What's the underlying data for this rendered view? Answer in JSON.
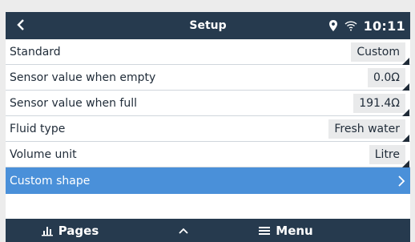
{
  "header": {
    "title": "Setup",
    "time": "10:11"
  },
  "settings": [
    {
      "label": "Standard",
      "value": "Custom"
    },
    {
      "label": "Sensor value when empty",
      "value": "0.0Ω"
    },
    {
      "label": "Sensor value when full",
      "value": "191.4Ω"
    },
    {
      "label": "Fluid type",
      "value": "Fresh water"
    },
    {
      "label": "Volume unit",
      "value": "Litre"
    }
  ],
  "submenu": {
    "label": "Custom shape"
  },
  "footer": {
    "pages_label": "Pages",
    "menu_label": "Menu"
  },
  "colors": {
    "header_bg": "#263a4e",
    "selected_row": "#4a90d9",
    "value_box": "#e9eaeb"
  }
}
